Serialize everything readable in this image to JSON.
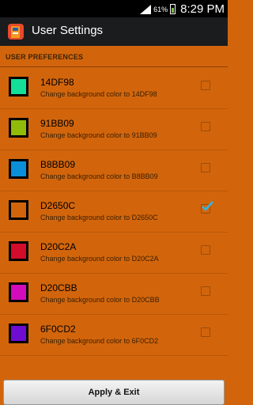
{
  "status_bar": {
    "battery_percent": "61%",
    "time": "8:29 PM",
    "signal_icon": "signal-icon",
    "battery_icon": "battery-icon"
  },
  "action_bar": {
    "title": "User Settings",
    "icon": "app-icon"
  },
  "section": {
    "header": "USER PREFERENCES"
  },
  "colors": [
    {
      "name": "14DF98",
      "description": "Change background color to 14DF98",
      "swatch": "#14DF98",
      "checked": false
    },
    {
      "name": "91BB09",
      "description": "Change background color to 91BB09",
      "swatch": "#91BB09",
      "checked": false
    },
    {
      "name": "B8BB09",
      "description": "Change background color to B8BB09",
      "swatch": "#0A8FD8",
      "checked": false
    },
    {
      "name": "D2650C",
      "description": "Change background color to D2650C",
      "swatch": "#D2650C",
      "checked": true
    },
    {
      "name": "D20C2A",
      "description": "Change background color to D20C2A",
      "swatch": "#D20C2A",
      "checked": false
    },
    {
      "name": "D20CBB",
      "description": "Change background color to D20CBB",
      "swatch": "#D20CBB",
      "checked": false
    },
    {
      "name": "6F0CD2",
      "description": "Change background color to 6F0CD2",
      "swatch": "#6F0CD2",
      "checked": false
    }
  ],
  "footer": {
    "apply_label": "Apply & Exit"
  },
  "theme": {
    "background": "#D2650C",
    "actionbar": "#1B1C1E",
    "check_accent": "#33B5E5"
  }
}
